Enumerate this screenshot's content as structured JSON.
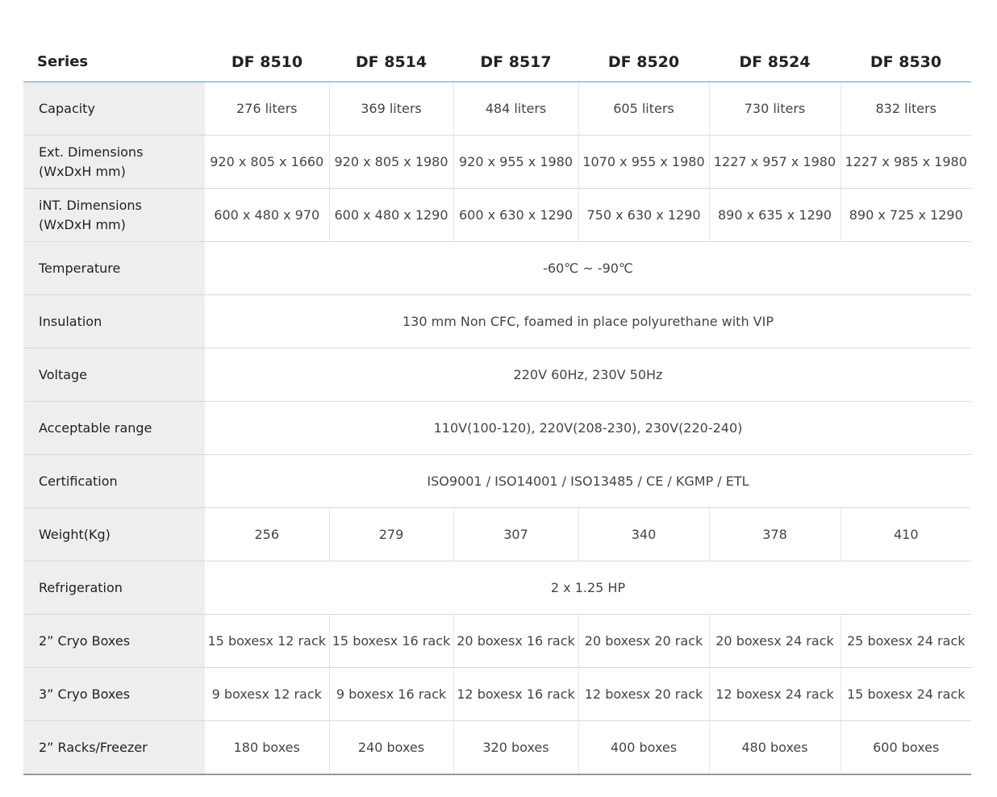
{
  "table": {
    "header_label": "Series",
    "models": [
      "DF 8510",
      "DF 8514",
      "DF 8517",
      "DF 8520",
      "DF 8524",
      "DF 8530"
    ],
    "rows": [
      {
        "label": "Capacity",
        "values": [
          "276 liters",
          "369 liters",
          "484 liters",
          "605 liters",
          "730 liters",
          "832 liters"
        ]
      },
      {
        "label": "Ext. Dimensions\n(WxDxH mm)",
        "values": [
          "920 x 805 x 1660",
          "920 x 805 x 1980",
          "920 x 955 x 1980",
          "1070 x 955 x 1980",
          "1227 x 957 x 1980",
          "1227 x 985 x 1980"
        ]
      },
      {
        "label": "iNT. Dimensions\n(WxDxH mm)",
        "values": [
          "600 x 480 x 970",
          "600 x 480 x 1290",
          "600 x 630 x 1290",
          "750 x 630 x 1290",
          "890 x 635 x 1290",
          "890 x 725 x 1290"
        ]
      },
      {
        "label": "Temperature",
        "span_value": "-60℃ ~ -90℃"
      },
      {
        "label": "Insulation",
        "span_value": "130 mm Non CFC, foamed in place polyurethane with VIP"
      },
      {
        "label": "Voltage",
        "span_value": "220V 60Hz, 230V 50Hz"
      },
      {
        "label": "Acceptable range",
        "span_value": "110V(100-120), 220V(208-230), 230V(220-240)"
      },
      {
        "label": "Certification",
        "span_value": "ISO9001 / ISO14001 / ISO13485 / CE / KGMP / ETL"
      },
      {
        "label": "Weight(Kg)",
        "values": [
          "256",
          "279",
          "307",
          "340",
          "378",
          "410"
        ]
      },
      {
        "label": "Refrigeration",
        "span_value": "2 x 1.25 HP"
      },
      {
        "label": "2” Cryo Boxes",
        "values": [
          "15 boxesx 12 rack",
          "15 boxesx 16 rack",
          "20 boxesx 16 rack",
          "20 boxesx 20 rack",
          "20 boxesx 24 rack",
          "25 boxesx 24 rack"
        ]
      },
      {
        "label": "3” Cryo Boxes",
        "values": [
          "9 boxesx 12 rack",
          "9 boxesx 16 rack",
          "12 boxesx 16 rack",
          "12 boxesx 20 rack",
          "12 boxesx 24 rack",
          "15 boxesx 24 rack"
        ]
      },
      {
        "label": "2” Racks/Freezer",
        "values": [
          "180 boxes",
          "240 boxes",
          "320 boxes",
          "400 boxes",
          "480 boxes",
          "600 boxes"
        ]
      }
    ]
  }
}
